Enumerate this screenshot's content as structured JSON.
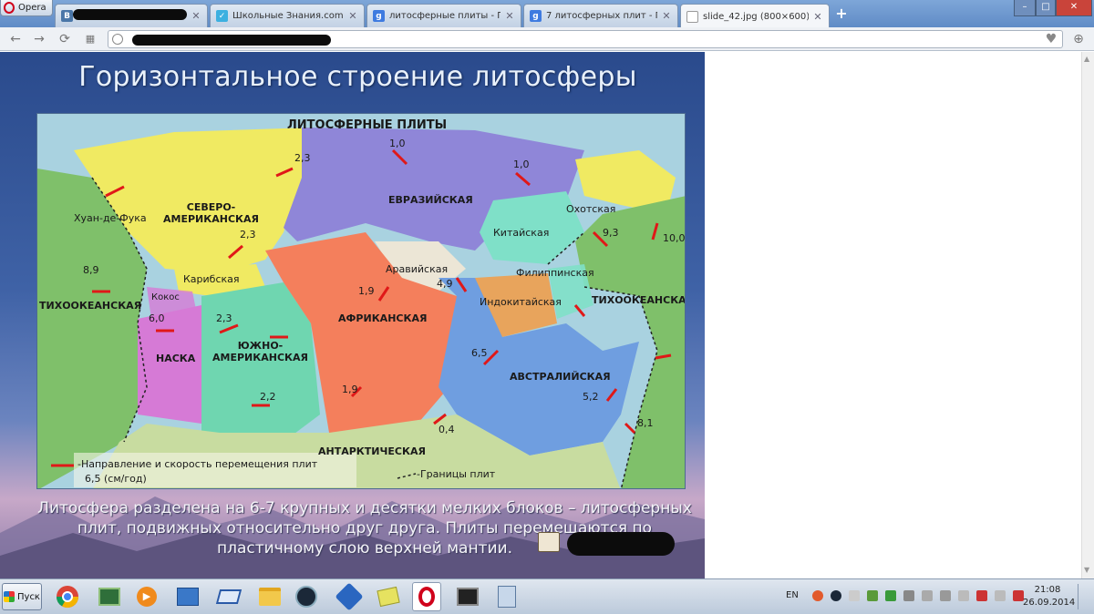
{
  "browser": {
    "menu_label": "Opera",
    "tabs": [
      {
        "title": "",
        "favicon": "vk-icon",
        "redacted": true
      },
      {
        "title": "Школьные Знания.com - Ре",
        "favicon": "znanija-icon"
      },
      {
        "title": "литосферные плиты - Поис",
        "favicon": "google-icon"
      },
      {
        "title": "7 литосферных плит - Поис",
        "favicon": "google-icon"
      },
      {
        "title": "slide_42.jpg (800×600)",
        "favicon": "page-icon",
        "active": true
      }
    ],
    "new_tab_label": "+",
    "window_controls": [
      "–",
      "□",
      "✕"
    ]
  },
  "slide": {
    "title": "Горизонтальное строение литосферы",
    "map": {
      "heading": "ЛИТОСФЕРНЫЕ ПЛИТЫ",
      "plates": {
        "juan": "Хуан-де-Фука",
        "north_america": "СЕВЕРО-\nАМЕРИКАНСКАЯ",
        "eurasia": "ЕВРАЗИЙСКАЯ",
        "china": "Китайская",
        "okhotsk": "Охотская",
        "pacific_left": "ТИХООКЕАНСКАЯ",
        "pacific_right": "ТИХООКЕАНСКАЯ",
        "caribbean": "Карибская",
        "cocos": "Кокос",
        "nazca": "НАСКА",
        "south_america": "ЮЖНО-\nАМЕРИКАНСКАЯ",
        "africa": "АФРИКАНСКАЯ",
        "arabia": "Аравийская",
        "philippine": "Филиппинская",
        "indochina": "Индокитайская",
        "australia": "АВСТРАЛИЙСКАЯ",
        "antarctica": "АНТАРКТИЧЕСКАЯ"
      },
      "speeds": [
        "1,0",
        "1,0",
        "2,3",
        "2,3",
        "8,9",
        "10,0",
        "9,3",
        "1,9",
        "4,9",
        "6,0",
        "2,3",
        "2,2",
        "1,9",
        "6,5",
        "5,2",
        "0,4",
        "8,1"
      ],
      "legend_direction": "-Направление и скорость перемещения плит",
      "legend_units": "6,5 (см/год)",
      "legend_boundaries": "-Границы плит",
      "colors": {
        "north_america": "#f0ea62",
        "eurasia": "#8f86d8",
        "pacific": "#7fc06a",
        "africa": "#f47f5c",
        "south_america": "#6fd6b0",
        "nazca": "#d67ad6",
        "australia": "#6f9ee0",
        "china": "#7fe0c8",
        "indochina": "#e8a45c",
        "arabia": "#ece6d6",
        "antarctica": "#c8dca0",
        "arrow": "#e01818"
      }
    },
    "caption": "Литосфера разделена на 6-7 крупных и десятки мелких блоков – литосферных плит, подвижных относительно друг друга. Плиты перемещаются по пластичному слою верхней мантии."
  },
  "taskbar": {
    "start_label": "Пуск",
    "apps": [
      "chrome-icon",
      "ccleaner-icon",
      "media-player-icon",
      "network-icon",
      "virtualbox-icon",
      "folder-icon",
      "steam-icon",
      "game-icon",
      "notes-icon",
      "opera-icon",
      "terminal-icon",
      "calculator-icon"
    ],
    "lang": "EN",
    "time": "21:08",
    "date": "26.09.2014"
  }
}
